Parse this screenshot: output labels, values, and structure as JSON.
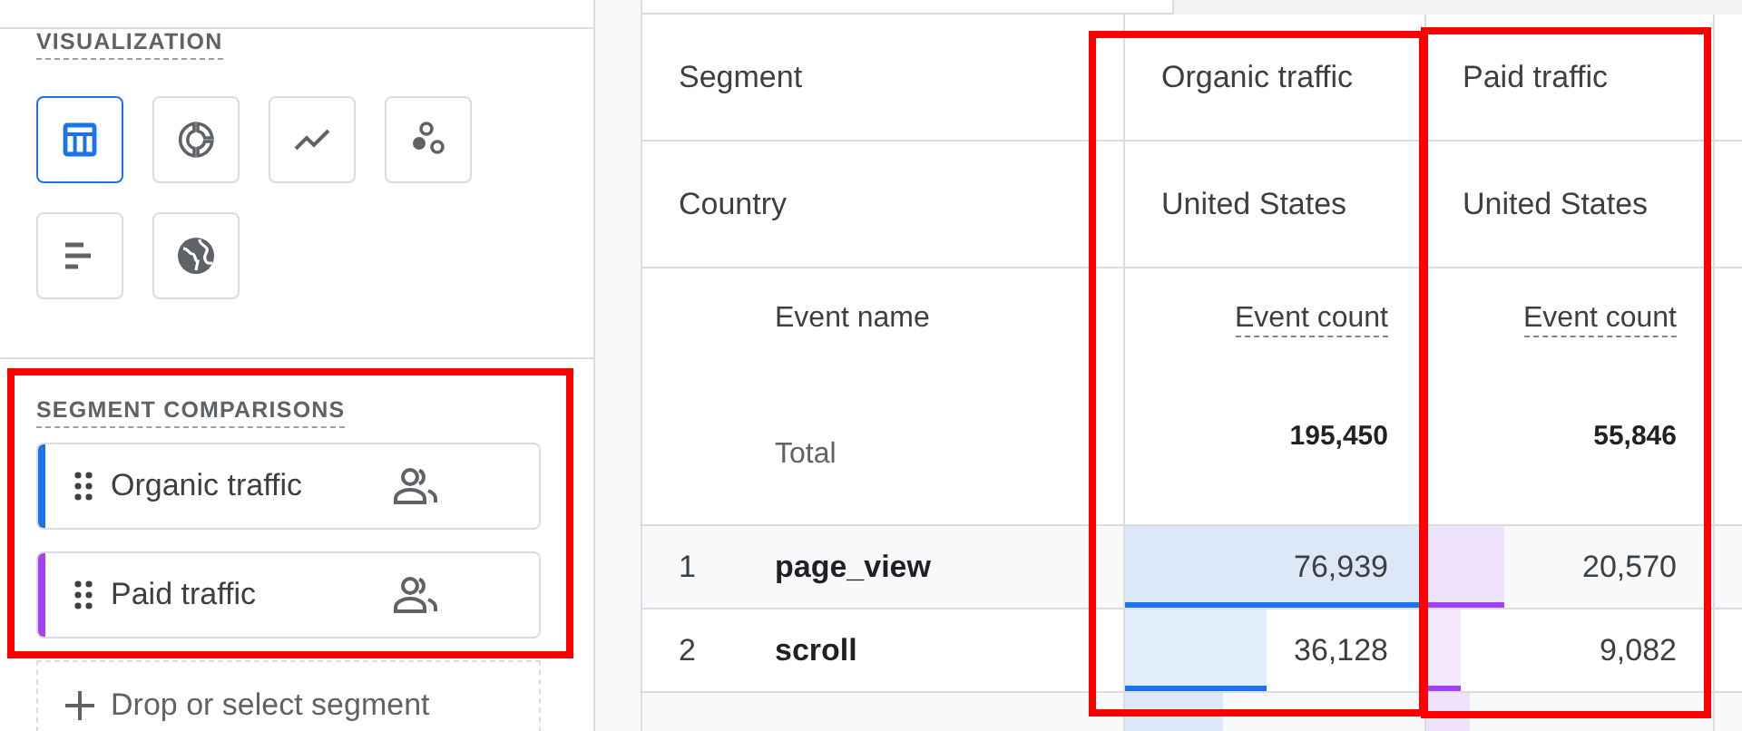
{
  "sidebar": {
    "visualization": {
      "title": "VISUALIZATION",
      "options": [
        {
          "kind": "table",
          "selected": true
        },
        {
          "kind": "donut",
          "selected": false
        },
        {
          "kind": "line",
          "selected": false
        },
        {
          "kind": "scatter",
          "selected": false
        },
        {
          "kind": "bar",
          "selected": false
        },
        {
          "kind": "map",
          "selected": false
        }
      ]
    },
    "segment_comparisons": {
      "title": "SEGMENT COMPARISONS",
      "segments": [
        {
          "name": "Organic traffic",
          "color": "#1a73e8"
        },
        {
          "name": "Paid traffic",
          "color": "#a142f4"
        }
      ],
      "drop_target": "Drop or select segment"
    }
  },
  "table": {
    "row_headers": [
      "Segment",
      "Country"
    ],
    "dimension_header": "Event name",
    "total_label": "Total",
    "columns": [
      {
        "segment": "Organic traffic",
        "country": "United States",
        "metric": "Event count",
        "total": "195,450"
      },
      {
        "segment": "Paid traffic",
        "country": "United States",
        "metric": "Event count",
        "total": "55,846"
      }
    ],
    "rows": [
      {
        "index": "1",
        "event": "page_view",
        "cells": [
          {
            "value": "76,939",
            "level": 1
          },
          {
            "value": "20,570",
            "level": 0.27
          }
        ]
      },
      {
        "index": "2",
        "event": "scroll",
        "cells": [
          {
            "value": "36,128",
            "level": 0.47
          },
          {
            "value": "9,082",
            "level": 0.12
          }
        ]
      },
      {
        "cells": [
          {
            "level": 0.33
          },
          {
            "level": 0.15
          }
        ]
      }
    ]
  }
}
